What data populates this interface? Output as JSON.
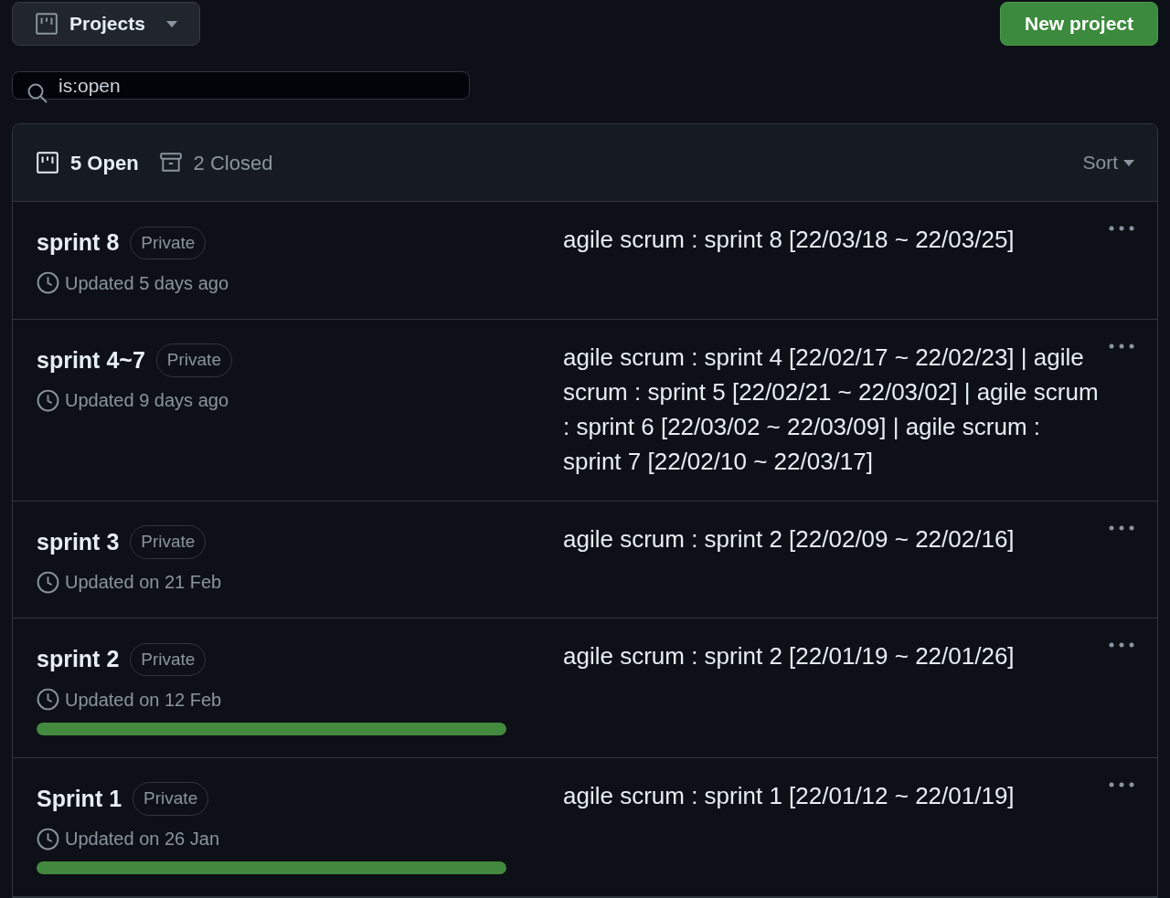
{
  "header": {
    "menu_label": "Projects",
    "new_button": "New project"
  },
  "search": {
    "value": "is:open"
  },
  "list_header": {
    "tabs": [
      {
        "label": "5 Open",
        "kind": "open",
        "selected": true
      },
      {
        "label": "2 Closed",
        "kind": "closed",
        "selected": false
      }
    ],
    "sort": "Sort"
  },
  "projects": [
    {
      "title": "sprint 8",
      "badge": "Private",
      "updated": "Updated 5 days ago",
      "description": "agile scrum : sprint 8 [22/03/18 ~ 22/03/25]"
    },
    {
      "title": "sprint 4~7",
      "badge": "Private",
      "updated": "Updated 9 days ago",
      "description": "agile scrum : sprint 4 [22/02/17 ~ 22/02/23] | agile scrum : sprint 5 [22/02/21 ~ 22/03/02] | agile scrum : sprint 6 [22/03/02 ~ 22/03/09] | agile scrum : sprint 7 [22/02/10 ~ 22/03/17]"
    },
    {
      "title": "sprint 3",
      "badge": "Private",
      "updated": "Updated on 21 Feb",
      "description": "agile scrum : sprint 2 [22/02/09 ~ 22/02/16]"
    },
    {
      "title": "sprint 2",
      "badge": "Private",
      "updated": "Updated on 12 Feb",
      "description": "agile scrum : sprint 2 [22/01/19 ~ 22/01/26]",
      "level": 1
    },
    {
      "title": "Sprint 1",
      "badge": "Private",
      "updated": "Updated on 26 Jan",
      "description": "agile scrum : sprint 1 [22/01/12 ~ 22/01/19]",
      "level": 1
    }
  ]
}
